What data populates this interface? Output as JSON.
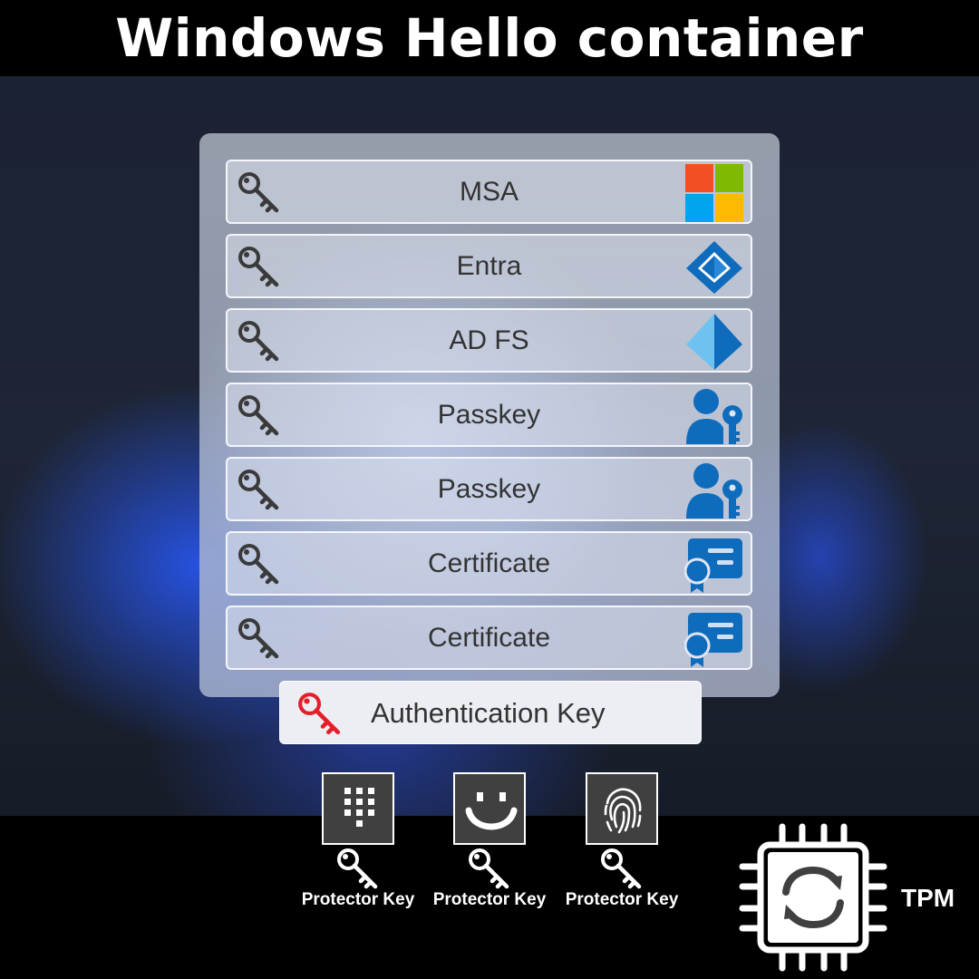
{
  "title": "Windows Hello container",
  "container": {
    "credentials": [
      {
        "label": "MSA",
        "logo_icon": "microsoft-logo-icon"
      },
      {
        "label": "Entra",
        "logo_icon": "entra-logo-icon"
      },
      {
        "label": "AD FS",
        "logo_icon": "adfs-logo-icon"
      },
      {
        "label": "Passkey",
        "logo_icon": "passkey-user-key-icon"
      },
      {
        "label": "Passkey",
        "logo_icon": "passkey-user-key-icon"
      },
      {
        "label": "Certificate",
        "logo_icon": "certificate-icon"
      },
      {
        "label": "Certificate",
        "logo_icon": "certificate-icon"
      }
    ],
    "authentication_key": {
      "label": "Authentication Key",
      "icon": "red-key-icon",
      "color": "#e3202a"
    }
  },
  "factors": [
    {
      "icon": "pin-keypad-icon",
      "key_label": "Protector Key"
    },
    {
      "icon": "face-smile-icon",
      "key_label": "Protector Key"
    },
    {
      "icon": "fingerprint-icon",
      "key_label": "Protector Key"
    }
  ],
  "tpm": {
    "label": "TPM",
    "icon": "tpm-chip-sync-icon"
  },
  "colors": {
    "accent_blue": "#0f6cbd",
    "ms_red": "#f25022",
    "ms_green": "#7fba00",
    "ms_blue": "#00a4ef",
    "ms_yellow": "#ffb900",
    "key_gray": "#3a3a3a",
    "key_red": "#e3202a"
  }
}
